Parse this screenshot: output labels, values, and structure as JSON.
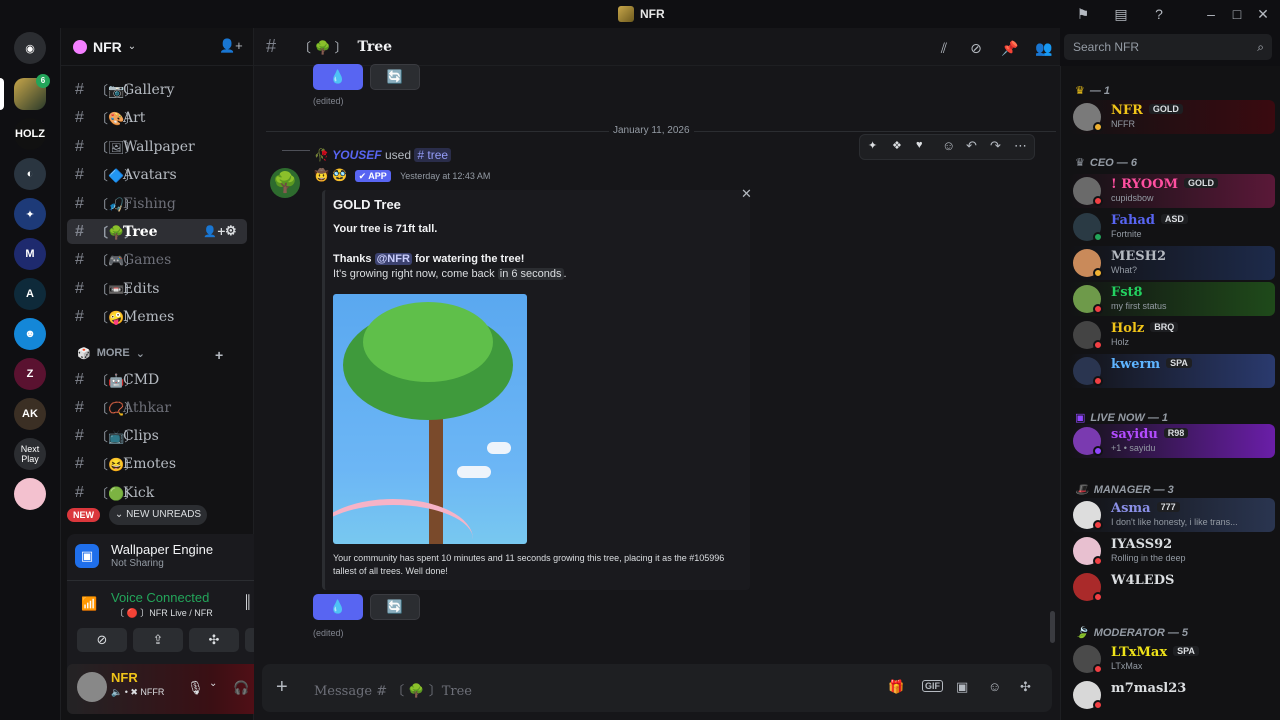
{
  "window": {
    "title": "NFR"
  },
  "guild": {
    "name": "NFR"
  },
  "channels": [
    {
      "label": "Gallery",
      "emoji": "📷"
    },
    {
      "label": "Art",
      "emoji": "🎨"
    },
    {
      "label": "Wallpaper",
      "emoji": "🖼"
    },
    {
      "label": "Avatars",
      "emoji": "🔷"
    },
    {
      "label": "Fishing",
      "emoji": "🎣"
    },
    {
      "label": "Tree",
      "emoji": "🌳"
    },
    {
      "label": "Games",
      "emoji": "🎮"
    },
    {
      "label": "Edits",
      "emoji": "📼"
    },
    {
      "label": "Memes",
      "emoji": "🤪"
    }
  ],
  "more_category": "MORE",
  "more_channels": [
    {
      "label": "CMD",
      "emoji": "🤖"
    },
    {
      "label": "Athkar",
      "emoji": "📿"
    },
    {
      "label": "Clips",
      "emoji": "📺"
    },
    {
      "label": "Emotes",
      "emoji": "😆"
    },
    {
      "label": "Kick",
      "emoji": "🟢"
    }
  ],
  "unreads": {
    "new_badge": "NEW",
    "new_unreads": "NEW UNREADS"
  },
  "servers": {
    "next_play": "Next Play",
    "holz": "HOLZ",
    "ak": "AK",
    "badge": "6"
  },
  "activity": {
    "app": "Wallpaper Engine",
    "state": "Not Sharing"
  },
  "voice": {
    "status": "Voice Connected",
    "location": "NFR Live / NFR"
  },
  "user": {
    "name": "NFR",
    "tag": "NFFR"
  },
  "main": {
    "channel": "Tree",
    "channel_emoji": "🌳",
    "search_placeholder": "Search NFR",
    "edited": "(edited)",
    "date": "January 11, 2026",
    "interaction": {
      "user": "YOUSEF",
      "used": "used",
      "command": "tree"
    },
    "bot": {
      "badge": "✔ APP",
      "timestamp": "Yesterday at 12:43 AM"
    },
    "embed": {
      "title": "GOLD Tree",
      "height_line": "Your tree is 71ft tall.",
      "thanks_pre": "Thanks",
      "thanks_mention": "@NFR",
      "thanks_post": "for watering the tree!",
      "growing_pre": "It's growing right now, come back",
      "growing_code": "in 6 seconds",
      "growing_post": ".",
      "footer": "Your community has spent 10 minutes and 11 seconds growing this tree, placing it as the #105996 tallest of all trees. Well done!"
    },
    "composer_placeholder": "Message # 〔 🌳 〕Tree"
  },
  "members": {
    "categories": {
      "owner": "— 1",
      "ceo": "CEO — 6",
      "live": "LIVE NOW — 1",
      "manager": "MANAGER — 3",
      "moderator": "MODERATOR — 5"
    },
    "list": [
      {
        "name": "NFR",
        "tag": "GOLD",
        "sub": "NFFR"
      },
      {
        "name": "! RYOOM",
        "tag": "GOLD",
        "sub": "cupidsbow"
      },
      {
        "name": "Fahad",
        "tag": "ASD",
        "sub": "Fortnite"
      },
      {
        "name": "MESH2",
        "tag": "",
        "sub": "What?"
      },
      {
        "name": "Fst8",
        "tag": "",
        "sub": "my first status"
      },
      {
        "name": "Holz",
        "tag": "BRQ",
        "sub": "Holz"
      },
      {
        "name": "kwerm",
        "tag": "SPA",
        "sub": ""
      },
      {
        "name": "sayidu",
        "tag": "R98",
        "sub": "+1 • sayidu"
      },
      {
        "name": "Asma",
        "tag": "777",
        "sub": "I don't like honesty, i like trans..."
      },
      {
        "name": "IYASS92",
        "tag": "",
        "sub": "Rolling in the deep"
      },
      {
        "name": "W4LEDS",
        "tag": "",
        "sub": ""
      },
      {
        "name": "LTxMax",
        "tag": "SPA",
        "sub": "LTxMax"
      },
      {
        "name": "m7masl23",
        "tag": "",
        "sub": ""
      }
    ]
  },
  "colors": {
    "accent": "#5865f2",
    "gold": "#f0c419",
    "pink": "#ff4fa0",
    "live": "#9146ff"
  }
}
